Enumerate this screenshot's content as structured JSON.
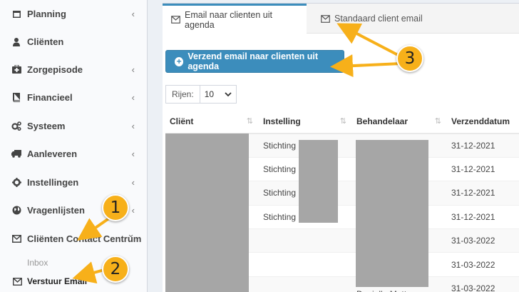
{
  "sidebar": {
    "items": [
      {
        "label": "Planning",
        "icon": "calendar-icon",
        "chevron": "‹"
      },
      {
        "label": "Cliënten",
        "icon": "user-icon",
        "chevron": ""
      },
      {
        "label": "Zorgepisode",
        "icon": "medkit-icon",
        "chevron": "‹"
      },
      {
        "label": "Financieel",
        "icon": "book-icon",
        "chevron": "‹"
      },
      {
        "label": "Systeem",
        "icon": "gears-icon",
        "chevron": "‹"
      },
      {
        "label": "Aanleveren",
        "icon": "truck-icon",
        "chevron": "‹"
      },
      {
        "label": "Instellingen",
        "icon": "gear-icon",
        "chevron": "‹"
      },
      {
        "label": "Vragenlijsten",
        "icon": "globe-icon",
        "chevron": "‹"
      },
      {
        "label": "Cliënten Contact Centrum",
        "icon": "envelope-icon",
        "chevron": "⌄"
      }
    ],
    "subitems": [
      {
        "label": "Inbox"
      },
      {
        "label": "Verstuur Email",
        "icon": "envelope-icon"
      }
    ]
  },
  "tabs": [
    {
      "label": "Email naar clienten uit agenda",
      "icon": "envelope-icon"
    },
    {
      "label": "Standaard client email",
      "icon": "envelope-icon"
    }
  ],
  "send_button": {
    "label": "Verzend email naar clienten uit agenda",
    "icon": "plus-circle-icon"
  },
  "rows_control": {
    "label": "Rijen:",
    "value": "10"
  },
  "table": {
    "headers": [
      "Cliënt",
      "Instelling",
      "Behandelaar",
      "Verzenddatum"
    ],
    "sort_icon": "⇅",
    "rows": [
      {
        "instelling": "Stichting",
        "behandelaar": "",
        "datum": "31-12-2021"
      },
      {
        "instelling": "Stichting",
        "behandelaar": "",
        "datum": "31-12-2021"
      },
      {
        "instelling": "Stichting",
        "behandelaar": "",
        "datum": "31-12-2021"
      },
      {
        "instelling": "Stichting",
        "behandelaar": "",
        "datum": "31-12-2021"
      },
      {
        "instelling": "",
        "behandelaar": "",
        "datum": "31-03-2022"
      },
      {
        "instelling": "",
        "behandelaar": "",
        "datum": "31-03-2022"
      },
      {
        "instelling": "",
        "behandelaar": "Danielle Matto",
        "datum": "31-03-2022"
      }
    ]
  },
  "annotations": {
    "badges": [
      "1",
      "2",
      "3"
    ],
    "color": "#f7b01a"
  },
  "colors": {
    "primary": "#3c8dbc",
    "sidebar_bg": "#f9fafc",
    "redaction": "#a6a6a6"
  }
}
